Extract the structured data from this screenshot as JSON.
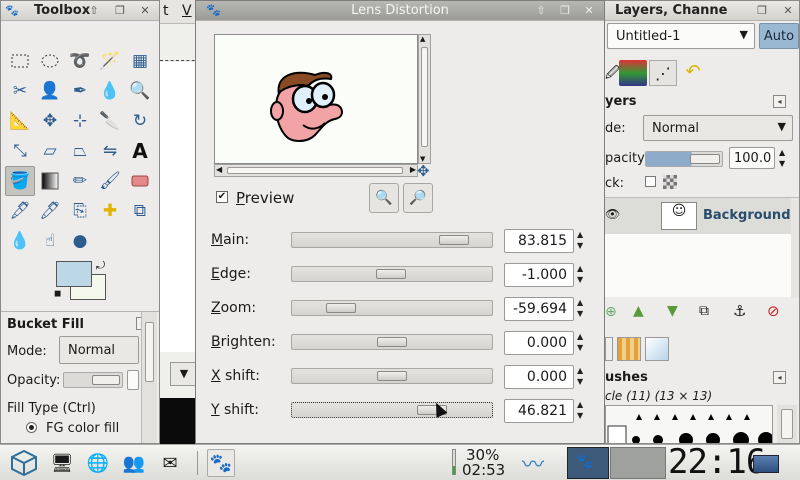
{
  "toolbox": {
    "title": "Toolbox",
    "tools": [
      "rect-select",
      "ellipse-select",
      "free-select",
      "fuzzy-select",
      "by-color-select",
      "scissors",
      "foreground-select",
      "paths",
      "color-picker",
      "zoom",
      "measure",
      "move",
      "align",
      "crop",
      "rotate",
      "scale",
      "shear",
      "perspective",
      "flip",
      "text",
      "bucket-fill",
      "blend",
      "pencil",
      "paintbrush",
      "eraser",
      "airbrush",
      "ink",
      "clone",
      "heal",
      "perspective-clone",
      "blur",
      "smudge",
      "dodge-burn"
    ],
    "fg_color": "#bcd8e6",
    "bg_color": "#f5f8ec",
    "tool_options_title": "Bucket Fill",
    "mode_label": "Mode:",
    "mode_value": "Normal",
    "opacity_label": "Opacity:",
    "fill_type_label": "Fill Type  (Ctrl)",
    "fill_option": "FG color fill"
  },
  "image_window": {
    "menu_fragment_1": "t",
    "menu_fragment_2": "V"
  },
  "dialog": {
    "title": "Lens Distortion",
    "preview_label": "Preview",
    "preview_checked": true,
    "params": [
      {
        "label": "Main:",
        "value": "83.815",
        "level": 0.864
      },
      {
        "label": "Edge:",
        "value": "-1.000",
        "level": 0.495
      },
      {
        "label": "Zoom:",
        "value": "-59.694",
        "level": 0.2
      },
      {
        "label": "Brighten:",
        "value": "0.000",
        "level": 0.5
      },
      {
        "label": "X shift:",
        "value": "0.000",
        "level": 0.5
      },
      {
        "label": "Y shift:",
        "value": "46.821",
        "level": 0.734
      }
    ]
  },
  "layers": {
    "title": "Layers, Channe",
    "image_select": "Untitled-1",
    "auto_label": "Auto",
    "section_title": "yers",
    "mode_label": "de:",
    "mode_value": "Normal",
    "opacity_label": "pacity:",
    "opacity_value": "100.0",
    "lock_label": "ck:",
    "layer_name": "Background",
    "brushes_title": "ushes",
    "brush_info": "cle (11) (13 × 13)"
  },
  "taskbar": {
    "battery_percent": "30%",
    "battery_time": "02:53",
    "clock": "22:16"
  }
}
